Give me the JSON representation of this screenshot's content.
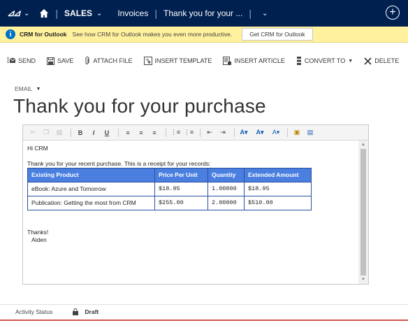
{
  "nav": {
    "app_area": "SALES",
    "entity": "Invoices",
    "record": "Thank you for your ..."
  },
  "notification": {
    "title": "CRM for Outlook",
    "message": "See how CRM for Outlook makes you even more productive.",
    "button": "Get CRM for Outlook"
  },
  "commands": [
    {
      "label": "SEND",
      "icon": "send-icon"
    },
    {
      "label": "SAVE",
      "icon": "save-icon"
    },
    {
      "label": "ATTACH FILE",
      "icon": "attach-icon"
    },
    {
      "label": "INSERT TEMPLATE",
      "icon": "insert-template-icon"
    },
    {
      "label": "INSERT ARTICLE",
      "icon": "insert-article-icon"
    },
    {
      "label": "CONVERT TO",
      "icon": "convert-icon"
    },
    {
      "label": "DELETE",
      "icon": "delete-icon"
    }
  ],
  "form": {
    "entity_label": "EMAIL",
    "title": "Thank you for your purchase"
  },
  "email_body": {
    "greeting": "Hi CRM",
    "intro": "Thank you for your recent purchase. This is a receipt for your records:",
    "table": {
      "headers": [
        "Existing Product",
        "Price Per Unit",
        "Quantity",
        "Extended Amount"
      ],
      "rows": [
        [
          "eBook: Azure and Tomorrow",
          "$18.95",
          "1.00000",
          "$18.95"
        ],
        [
          "Publication: Getting the most from CRM",
          "$255.00",
          "2.00000",
          "$510.00"
        ]
      ]
    },
    "closing": "Thanks!",
    "signature": "Aiden"
  },
  "footer": {
    "label": "Activity Status",
    "value": "Draft"
  },
  "colors": {
    "nav_bg": "#002050",
    "notification_bg": "#fff19d",
    "table_header_bg": "#4a7fe0"
  }
}
